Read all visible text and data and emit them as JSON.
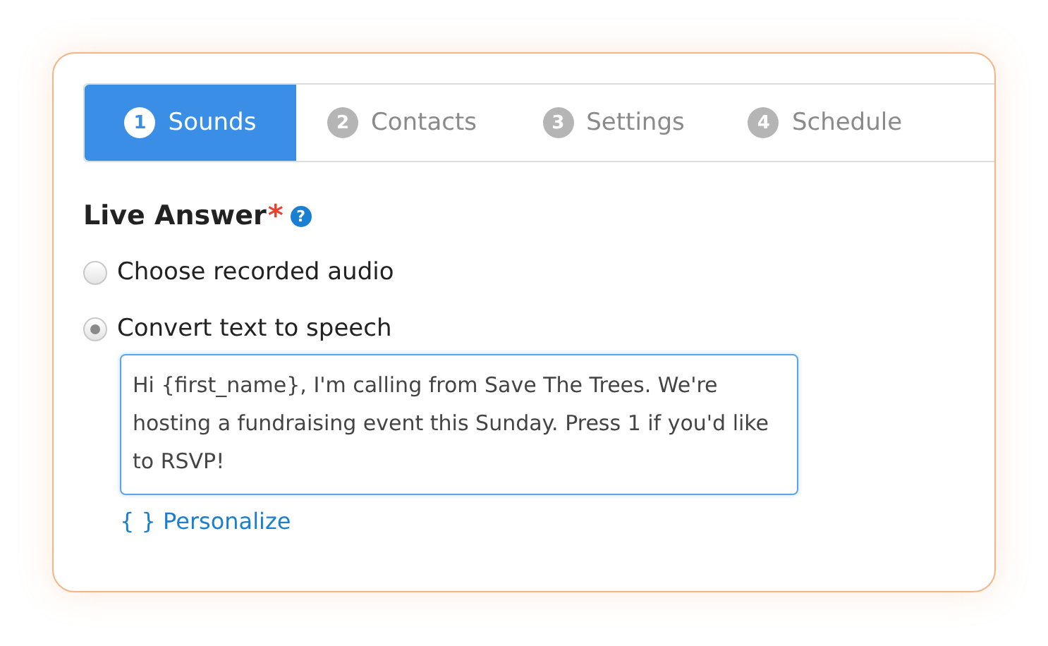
{
  "tabs": [
    {
      "number": "1",
      "label": "Sounds",
      "selected": true
    },
    {
      "number": "2",
      "label": "Contacts",
      "selected": false
    },
    {
      "number": "3",
      "label": "Settings",
      "selected": false
    },
    {
      "number": "4",
      "label": "Schedule",
      "selected": false
    }
  ],
  "section": {
    "title": "Live Answer",
    "required_mark": "*",
    "help": "?"
  },
  "options": [
    {
      "label": "Choose recorded audio",
      "selected": false
    },
    {
      "label": "Convert text to speech",
      "selected": true
    }
  ],
  "message": {
    "value": "Hi {first_name}, I'm calling from Save The Trees. We're hosting a fundraising event this Sunday. Press 1 if you'd like to RSVP!"
  },
  "personalize_link": "{ } Personalize"
}
